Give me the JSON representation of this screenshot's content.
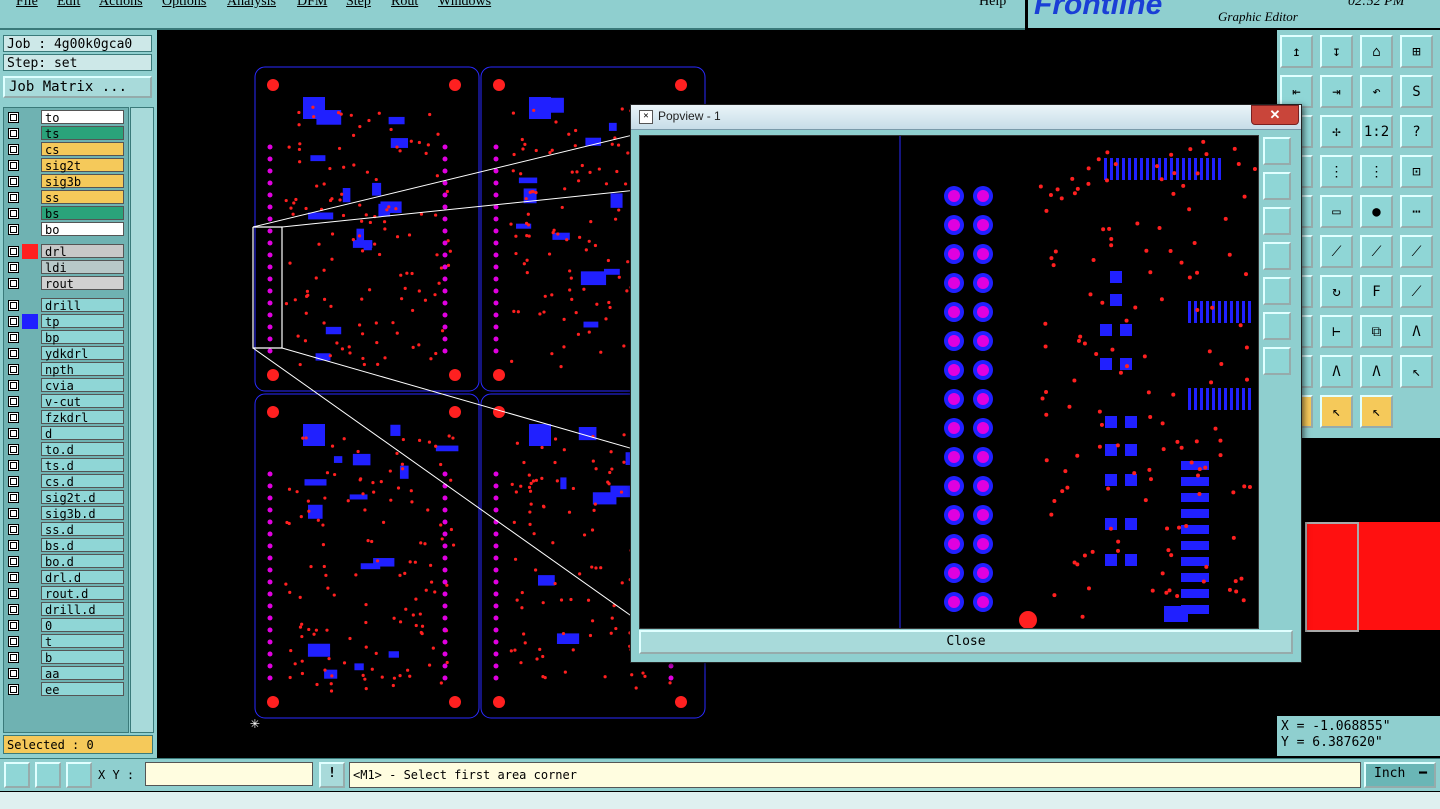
{
  "menubar": {
    "items": [
      "File",
      "Edit",
      "Actions",
      "Options",
      "Analysis",
      "DFM",
      "Step",
      "Rout",
      "Windows"
    ],
    "help": "Help"
  },
  "header": {
    "logo": "Frontline",
    "subtitle": "Graphic Editor",
    "clock": "02:52 PM"
  },
  "left_panel": {
    "job": "Job : 4g00k0gca0",
    "step": "Step: set",
    "job_matrix_button": "Job Matrix ...",
    "layers": [
      {
        "name": "to",
        "color": "#ffffff",
        "mark": ""
      },
      {
        "name": "ts",
        "color": "#2aa37a",
        "mark": ""
      },
      {
        "name": "cs",
        "color": "#f5c95a",
        "mark": ""
      },
      {
        "name": "sig2t",
        "color": "#f5c95a",
        "mark": ""
      },
      {
        "name": "sig3b",
        "color": "#f5c95a",
        "mark": ""
      },
      {
        "name": "ss",
        "color": "#f5c95a",
        "mark": ""
      },
      {
        "name": "bs",
        "color": "#2aa37a",
        "mark": ""
      },
      {
        "name": "bo",
        "color": "#ffffff",
        "mark": ""
      },
      {
        "name": "drl",
        "color": "#c8c8c8",
        "mark": "#ff2020",
        "active": true
      },
      {
        "name": "ldi",
        "color": "#b8c8c8",
        "mark": ""
      },
      {
        "name": "rout",
        "color": "#d0d0d0",
        "mark": ""
      },
      {
        "name": "drill",
        "color": "#8fd6d6",
        "mark": ""
      },
      {
        "name": "tp",
        "color": "#8fd6d6",
        "mark": "#2020ff"
      },
      {
        "name": "bp",
        "color": "#8fd6d6",
        "mark": ""
      },
      {
        "name": "ydkdrl",
        "color": "#8fd6d6",
        "mark": ""
      },
      {
        "name": "npth",
        "color": "#8fd6d6",
        "mark": ""
      },
      {
        "name": "cvia",
        "color": "#8fd6d6",
        "mark": ""
      },
      {
        "name": "v-cut",
        "color": "#8fd6d6",
        "mark": ""
      },
      {
        "name": "fzkdrl",
        "color": "#8fd6d6",
        "mark": ""
      },
      {
        "name": "d",
        "color": "#8fd6d6",
        "mark": ""
      },
      {
        "name": "to.d",
        "color": "#8fd6d6",
        "mark": ""
      },
      {
        "name": "ts.d",
        "color": "#8fd6d6",
        "mark": ""
      },
      {
        "name": "cs.d",
        "color": "#8fd6d6",
        "mark": ""
      },
      {
        "name": "sig2t.d",
        "color": "#8fd6d6",
        "mark": ""
      },
      {
        "name": "sig3b.d",
        "color": "#8fd6d6",
        "mark": ""
      },
      {
        "name": "ss.d",
        "color": "#8fd6d6",
        "mark": ""
      },
      {
        "name": "bs.d",
        "color": "#8fd6d6",
        "mark": ""
      },
      {
        "name": "bo.d",
        "color": "#8fd6d6",
        "mark": ""
      },
      {
        "name": "drl.d",
        "color": "#8fd6d6",
        "mark": ""
      },
      {
        "name": "rout.d",
        "color": "#8fd6d6",
        "mark": ""
      },
      {
        "name": "drill.d",
        "color": "#8fd6d6",
        "mark": ""
      },
      {
        "name": "0",
        "color": "#8fd6d6",
        "mark": ""
      },
      {
        "name": "t",
        "color": "#8fd6d6",
        "mark": ""
      },
      {
        "name": "b",
        "color": "#8fd6d6",
        "mark": ""
      },
      {
        "name": "aa",
        "color": "#8fd6d6",
        "mark": ""
      },
      {
        "name": "ee",
        "color": "#8fd6d6",
        "mark": ""
      }
    ],
    "selected": "Selected : 0"
  },
  "popview": {
    "title": "Popview - 1",
    "close_x": "✕",
    "close_button": "Close"
  },
  "toolbox": {
    "tools": [
      "↥",
      "↧",
      "⌂",
      "⊞",
      "⇤",
      "⇥",
      "↶",
      "S",
      "✥",
      "✢",
      "1:2",
      "?",
      "⊸",
      "⋮",
      "⋮",
      "⊡",
      "⧅",
      "▭",
      "●",
      "⋯",
      "✕",
      "⟋",
      "⟋",
      "⟋",
      "⟋",
      "↻",
      "F",
      "⟋",
      "—",
      "⊢",
      "⧉",
      "Λ",
      "Λ",
      "Λ",
      "Λ",
      "↖",
      "↖",
      "↖",
      "↖"
    ]
  },
  "coords": {
    "x": "X = -1.068855\"",
    "y": "Y = 6.387620\""
  },
  "bottombar": {
    "xy_label": "X Y :",
    "xy_value": "",
    "bang": "!",
    "status": "<M1> - Select first area corner",
    "units": "Inch"
  },
  "colors": {
    "panel": "#8fcfcf",
    "pad_red": "#ff2020",
    "pad_blue": "#2020ff",
    "pad_magenta": "#e000e0"
  }
}
